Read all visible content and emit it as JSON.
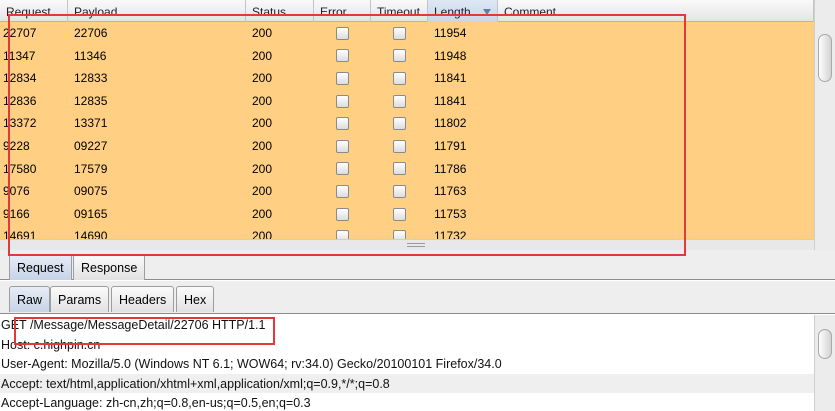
{
  "table": {
    "columns": [
      "Request",
      "Payload",
      "Status",
      "Error",
      "Timeout",
      "Length",
      "Comment"
    ],
    "sorted_column": "Length",
    "rows": [
      {
        "request": "22707",
        "payload": "22706",
        "status": "200",
        "error": false,
        "timeout": false,
        "length": "11954",
        "comment": ""
      },
      {
        "request": "11347",
        "payload": "11346",
        "status": "200",
        "error": false,
        "timeout": false,
        "length": "11948",
        "comment": ""
      },
      {
        "request": "12834",
        "payload": "12833",
        "status": "200",
        "error": false,
        "timeout": false,
        "length": "11841",
        "comment": ""
      },
      {
        "request": "12836",
        "payload": "12835",
        "status": "200",
        "error": false,
        "timeout": false,
        "length": "11841",
        "comment": ""
      },
      {
        "request": "13372",
        "payload": "13371",
        "status": "200",
        "error": false,
        "timeout": false,
        "length": "11802",
        "comment": ""
      },
      {
        "request": "9228",
        "payload": "09227",
        "status": "200",
        "error": false,
        "timeout": false,
        "length": "11791",
        "comment": ""
      },
      {
        "request": "17580",
        "payload": "17579",
        "status": "200",
        "error": false,
        "timeout": false,
        "length": "11786",
        "comment": ""
      },
      {
        "request": "9076",
        "payload": "09075",
        "status": "200",
        "error": false,
        "timeout": false,
        "length": "11763",
        "comment": ""
      },
      {
        "request": "9166",
        "payload": "09165",
        "status": "200",
        "error": false,
        "timeout": false,
        "length": "11753",
        "comment": ""
      },
      {
        "request": "14691",
        "payload": "14690",
        "status": "200",
        "error": false,
        "timeout": false,
        "length": "11732",
        "comment": ""
      }
    ],
    "row_highlight_color": "#ffcf84"
  },
  "top_tabs": [
    {
      "label": "Request",
      "active": true
    },
    {
      "label": "Response",
      "active": false
    }
  ],
  "sub_tabs": [
    {
      "label": "Raw",
      "active": true
    },
    {
      "label": "Params",
      "active": false
    },
    {
      "label": "Headers",
      "active": false
    },
    {
      "label": "Hex",
      "active": false
    }
  ],
  "raw_request": {
    "lines": [
      "GET /Message/MessageDetail/22706 HTTP/1.1",
      "Host: c.highpin.cn",
      "User-Agent: Mozilla/5.0 (Windows NT 6.1; WOW64; rv:34.0) Gecko/20100101 Firefox/34.0",
      "Accept: text/html,application/xhtml+xml,application/xml;q=0.9,*/*;q=0.8",
      "Accept-Language: zh-cn,zh;q=0.8,en-us;q=0.5,en;q=0.3"
    ],
    "highlighted_line": 3
  },
  "colors": {
    "annotation": "#e5383b",
    "active_tab": "#c5d3e8"
  }
}
